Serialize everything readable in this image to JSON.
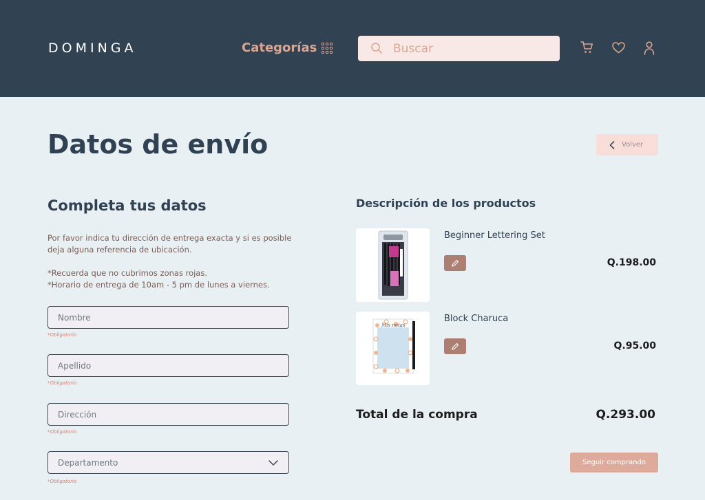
{
  "header": {
    "logo": "DOMINGA",
    "categories_label": "Categorías",
    "search_placeholder": "Buscar"
  },
  "page": {
    "title": "Datos de envío",
    "back_label": "Volver"
  },
  "form": {
    "title": "Completa tus datos",
    "intro_line1": "Por favor indica tu dirección de entrega exacta y si es posible deja alguna referencia de ubicación.",
    "intro_line2": "*Recuerda que no cubrimos zonas rojas.",
    "intro_line3": "*Horario de entrega de 10am - 5 pm de lunes a viernes.",
    "required_label": "*Obligatorio",
    "fields": [
      {
        "placeholder": "Nombre",
        "value": ""
      },
      {
        "placeholder": "Apellido",
        "value": ""
      },
      {
        "placeholder": "Dirección",
        "value": ""
      },
      {
        "placeholder": "Departamento",
        "value": "Departamento"
      }
    ]
  },
  "summary": {
    "title": "Descripción de los productos",
    "products": [
      {
        "name": "Beginner Lettering Set",
        "price": "Q.198.00",
        "thumb_text": "Lettering"
      },
      {
        "name": "Block Charuca",
        "price": "Q.95.00",
        "thumb_text": "Mis notas"
      }
    ],
    "total_label": "Total de la compra",
    "total_value": "Q.293.00",
    "continue_label": "Seguir comprando"
  },
  "colors": {
    "header_bg": "#314252",
    "page_bg": "#e9f0f4",
    "accent": "#dca592",
    "edit_button": "#ad7f73",
    "required": "#e47a6e"
  },
  "icons": [
    "grid-icon",
    "search-icon",
    "cart-icon",
    "heart-icon",
    "user-icon",
    "chevron-left-icon",
    "pencil-icon",
    "chevron-down-icon"
  ]
}
